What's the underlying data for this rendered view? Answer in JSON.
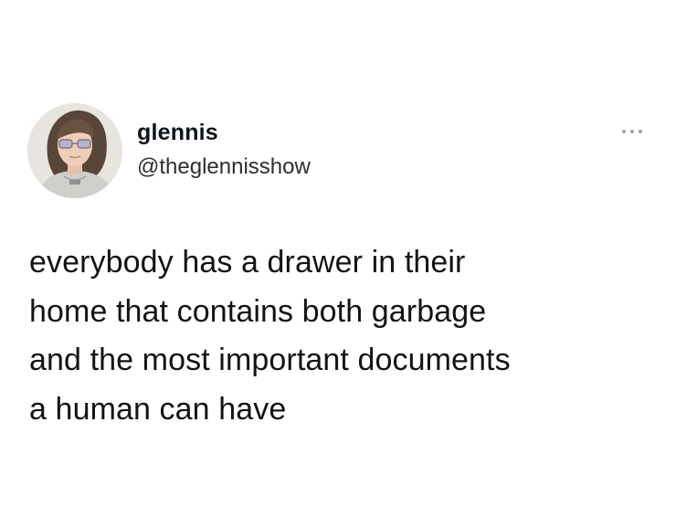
{
  "tweet": {
    "author": {
      "display_name": "glennis",
      "handle": "@theglennisshow",
      "avatar_icon": "profile-photo"
    },
    "menu_icon": "more-options-icon",
    "text_lines": [
      "everybody has a drawer in their",
      "home that contains both garbage",
      "and the most important documents",
      "a human can have"
    ]
  }
}
